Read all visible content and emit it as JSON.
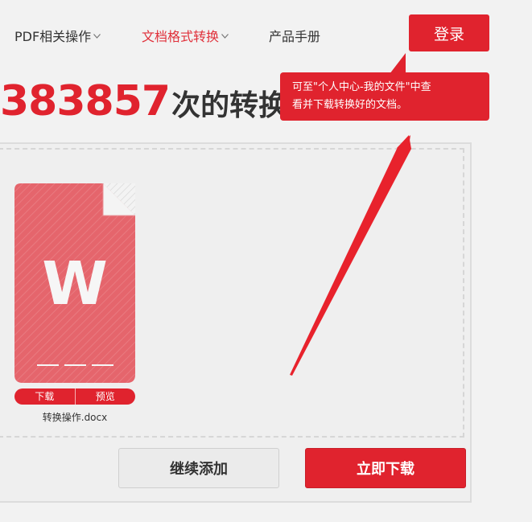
{
  "nav": {
    "items": [
      {
        "label": "PDF相关操作",
        "has_dropdown": true,
        "active": false
      },
      {
        "label": "文档格式转换",
        "has_dropdown": true,
        "active": true
      },
      {
        "label": "产品手册",
        "has_dropdown": false,
        "active": false
      }
    ],
    "login_label": "登录"
  },
  "headline": {
    "count": "383857",
    "suffix": "次的转换"
  },
  "tooltip": {
    "text_line1": "可至\"个人中心-我的文件\"中查",
    "text_line2": "看并下载转换好的文档。"
  },
  "file": {
    "icon_letter": "W",
    "download_label": "下载",
    "preview_label": "预览",
    "name": "转换操作.docx"
  },
  "actions": {
    "continue_label": "继续添加",
    "download_label": "立即下载"
  },
  "colors": {
    "brand_red": "#e0232e",
    "file_icon_red": "#e5656c",
    "text": "#333333",
    "background": "#f2f2f2"
  },
  "icons": {
    "dropdown": "chevron-down-icon",
    "file": "word-document-icon",
    "annotation": "red-arrow-annotation"
  }
}
